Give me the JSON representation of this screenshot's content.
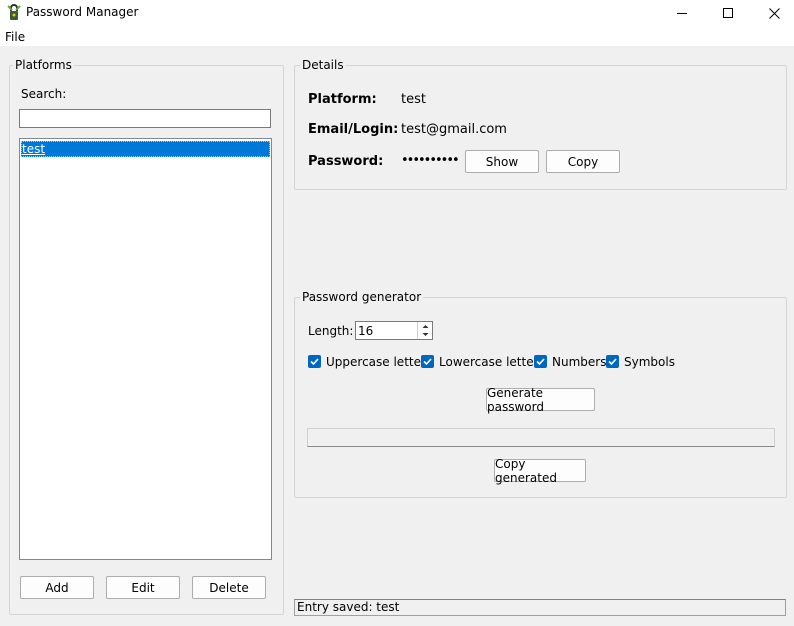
{
  "window": {
    "title": "Password Manager"
  },
  "menu": {
    "file": "File"
  },
  "platforms": {
    "group_title": "Platforms",
    "search_label": "Search:",
    "search_value": "",
    "items": [
      "test"
    ],
    "selected_index": 0,
    "add_label": "Add",
    "edit_label": "Edit",
    "delete_label": "Delete"
  },
  "details": {
    "group_title": "Details",
    "platform_label": "Platform:",
    "platform_value": "test",
    "email_label": "Email/Login:",
    "email_value": "test@gmail.com",
    "password_label": "Password:",
    "password_mask": "••••••••••",
    "show_label": "Show",
    "copy_label": "Copy"
  },
  "generator": {
    "group_title": "Password generator",
    "length_label": "Length:",
    "length_value": "16",
    "options": [
      {
        "label": "Uppercase letters",
        "checked": true
      },
      {
        "label": "Lowercase letters",
        "checked": true
      },
      {
        "label": "Numbers",
        "checked": true
      },
      {
        "label": "Symbols",
        "checked": true
      }
    ],
    "generate_label": "Generate password",
    "generated_value": "",
    "copy_generated_label": "Copy generated"
  },
  "status": {
    "text": "Entry saved: test"
  },
  "colors": {
    "accent": "#0078d7",
    "checkbox": "#0067c0"
  }
}
